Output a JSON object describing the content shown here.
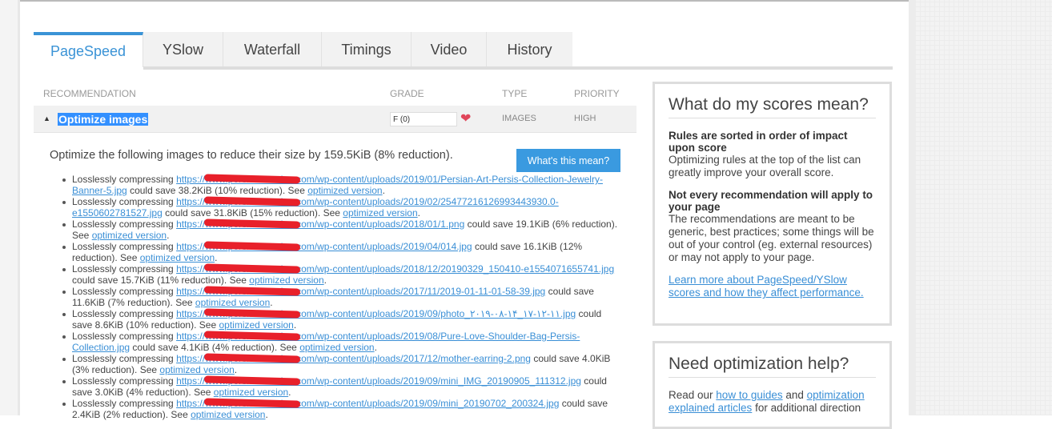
{
  "tabs": [
    "PageSpeed",
    "YSlow",
    "Waterfall",
    "Timings",
    "Video",
    "History"
  ],
  "table": {
    "headers": {
      "recommendation": "RECOMMENDATION",
      "grade": "GRADE",
      "type": "TYPE",
      "priority": "PRIORITY"
    },
    "row": {
      "title": "Optimize images",
      "grade": "F (0)",
      "type": "IMAGES",
      "priority": "HIGH"
    }
  },
  "detail": {
    "description": "Optimize the following images to reduce their size by 159.5KiB (8% reduction).",
    "button": "What's this mean?",
    "prefix": "Losslessly compressing",
    "see": "See",
    "link_label": "optimized version",
    "items": [
      {
        "url": "https://www.persiscollection.com/wp-content/uploads/2019/01/Persian-Art-Persis-Collection-Jewelry-Banner-5.jpg",
        "saving": "could save 38.2KiB (10% reduction)."
      },
      {
        "url": "https://www.persiscollection.com/wp-content/uploads/2019/02/25477216126993443930.0-e1550602781527.jpg",
        "saving": "could save 31.8KiB (15% reduction)."
      },
      {
        "url": "https://www.persiscollection.com/wp-content/uploads/2018/01/1.png",
        "saving": "could save 19.1KiB (6% reduction)."
      },
      {
        "url": "https://www.persiscollection.com/wp-content/uploads/2019/04/014.jpg",
        "saving": "could save 16.1KiB (12% reduction)."
      },
      {
        "url": "https://www.persiscollection.com/wp-content/uploads/2018/12/20190329_150410-e1554071655741.jpg",
        "saving": "could save 15.7KiB (11% reduction)."
      },
      {
        "url": "https://www.persiscollection.com/wp-content/uploads/2017/11/2019-01-11-01-58-39.jpg",
        "saving": "could save 11.6KiB (7% reduction)."
      },
      {
        "url": "https://www.persiscollection.com/wp-content/uploads/2019/09/photo_۲۰۱۹-۰۸-۱۴_۱۷-۱۲-۱۱.jpg",
        "saving": "could save 8.6KiB (10% reduction)."
      },
      {
        "url": "https://www.persiscollection.com/wp-content/uploads/2019/08/Pure-Love-Shoulder-Bag-Persis-Collection.jpg",
        "saving": "could save 4.1KiB (4% reduction)."
      },
      {
        "url": "https://www.persiscollection.com/wp-content/uploads/2017/12/mother-earring-2.png",
        "saving": "could save 4.0KiB (3% reduction)."
      },
      {
        "url": "https://www.persiscollection.com/wp-content/uploads/2019/09/mini_IMG_20190905_111312.jpg",
        "saving": "could save 3.0KiB (4% reduction)."
      },
      {
        "url": "https://www.persiscollection.com/wp-content/uploads/2019/09/mini_20190702_200324.jpg",
        "saving": "could save 2.4KiB (2% reduction)."
      }
    ]
  },
  "sidebar": {
    "box1": {
      "title": "What do my scores mean?",
      "h1": "Rules are sorted in order of impact upon score",
      "p1": "Optimizing rules at the top of the list can greatly improve your overall score.",
      "h2": "Not every recommendation will apply to your page",
      "p2": "The recommendations are meant to be generic, best practices; some things will be out of your control (eg. external resources) or may not apply to your page.",
      "link": "Learn more about PageSpeed/YSlow scores and how they affect performance."
    },
    "box2": {
      "title": "Need optimization help?",
      "t1": "Read our ",
      "l1": "how to guides",
      "t2": " and ",
      "l2": "optimization explained articles",
      "t3": " for additional direction"
    }
  }
}
